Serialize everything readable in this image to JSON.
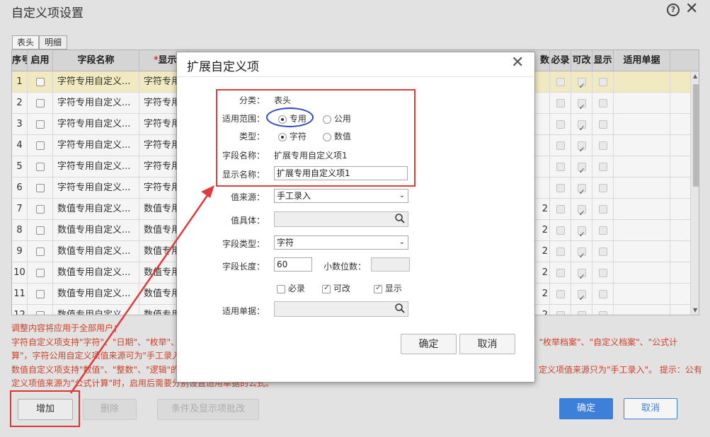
{
  "window": {
    "title": "自定义项设置",
    "help_glyph": "?",
    "close_glyph": "✕"
  },
  "tabs": [
    {
      "label": "表头",
      "active": true
    },
    {
      "label": "明细",
      "active": false
    }
  ],
  "grid": {
    "headers": {
      "seq": "序号",
      "enabled": "启用",
      "field_name": "字段名称",
      "display_req": "*",
      "display": "显示",
      "dec_tail": "数",
      "required": "必录",
      "editable": "可改",
      "show": "显示",
      "applicable": "适用单据"
    },
    "rows": [
      {
        "seq": "1",
        "field": "字符专用自定义...",
        "display": "字符专用",
        "dec": ""
      },
      {
        "seq": "2",
        "field": "字符专用自定义...",
        "display": "字符专用",
        "dec": ""
      },
      {
        "seq": "3",
        "field": "字符专用自定义...",
        "display": "字符专用",
        "dec": ""
      },
      {
        "seq": "4",
        "field": "字符专用自定义...",
        "display": "字符专用",
        "dec": ""
      },
      {
        "seq": "5",
        "field": "字符专用自定义...",
        "display": "字符专用",
        "dec": ""
      },
      {
        "seq": "6",
        "field": "字符专用自定义...",
        "display": "字符专用",
        "dec": ""
      },
      {
        "seq": "7",
        "field": "数值专用自定义...",
        "display": "数值专用",
        "dec": "2"
      },
      {
        "seq": "8",
        "field": "数值专用自定义...",
        "display": "数值专用",
        "dec": "2"
      },
      {
        "seq": "9",
        "field": "数值专用自定义...",
        "display": "数值专用",
        "dec": "2"
      },
      {
        "seq": "10",
        "field": "数值专用自定义...",
        "display": "数值专用",
        "dec": "2"
      },
      {
        "seq": "11",
        "field": "数值专用自定义...",
        "display": "数值专用",
        "dec": "2"
      },
      {
        "seq": "12",
        "field": "数值专用自定义...",
        "display": "数值专用",
        "dec": "2"
      }
    ]
  },
  "notes": [
    "调整内容将应用于全部用户；",
    "字符自定义项支持\"字符\"、\"日期\"、\"枚举\"、\"",
    "算\"，字符公用自定义项值来源可为\"手工录入",
    "数值自定义项支持\"数值\"、\"整数\"、\"逻辑\"的",
    "定义项值来源为\"公式计算\"时，启用后需要分别设置适用单据的公式。",
    "息\"、\"枚举档案\"、\"自定义档案\"、\"公式计",
    "定义项值来源只为\"手工录入\"。 提示：公有自"
  ],
  "buttons": {
    "add": "增加",
    "delete": "删除",
    "batch": "条件及显示项批改",
    "ok": "确定",
    "cancel": "取消"
  },
  "dialog": {
    "title": "扩展自定义项",
    "close_glyph": "✕",
    "category_label": "分类：",
    "category_value": "表头",
    "scope_label": "适用范围：",
    "scope_options": [
      "专用",
      "公用"
    ],
    "type_label": "类型：",
    "type_options": [
      "字符",
      "数值"
    ],
    "field_name_label": "字段名称：",
    "field_name_value": "扩展专用自定义项1",
    "display_name_label": "显示名称：",
    "display_name_value": "扩展专用自定义项1",
    "value_source_label": "值来源：",
    "value_source_value": "手工录入",
    "value_body_label": "值具体：",
    "field_type_label": "字段类型：",
    "field_type_value": "字符",
    "field_length_label": "字段长度：",
    "field_length_value": "60",
    "decimals_label": "小数位数：",
    "required_label": "必录",
    "editable_label": "可改",
    "show_label": "显示",
    "applicable_label": "适用单据：",
    "ok": "确定",
    "cancel": "取消"
  },
  "colors": {
    "note_red": "#d7452c",
    "primary_blue": "#3f86e2",
    "highlight_red": "#e03a3a",
    "oval_blue": "#2b44c9",
    "selected_row": "#fbf4c8"
  }
}
